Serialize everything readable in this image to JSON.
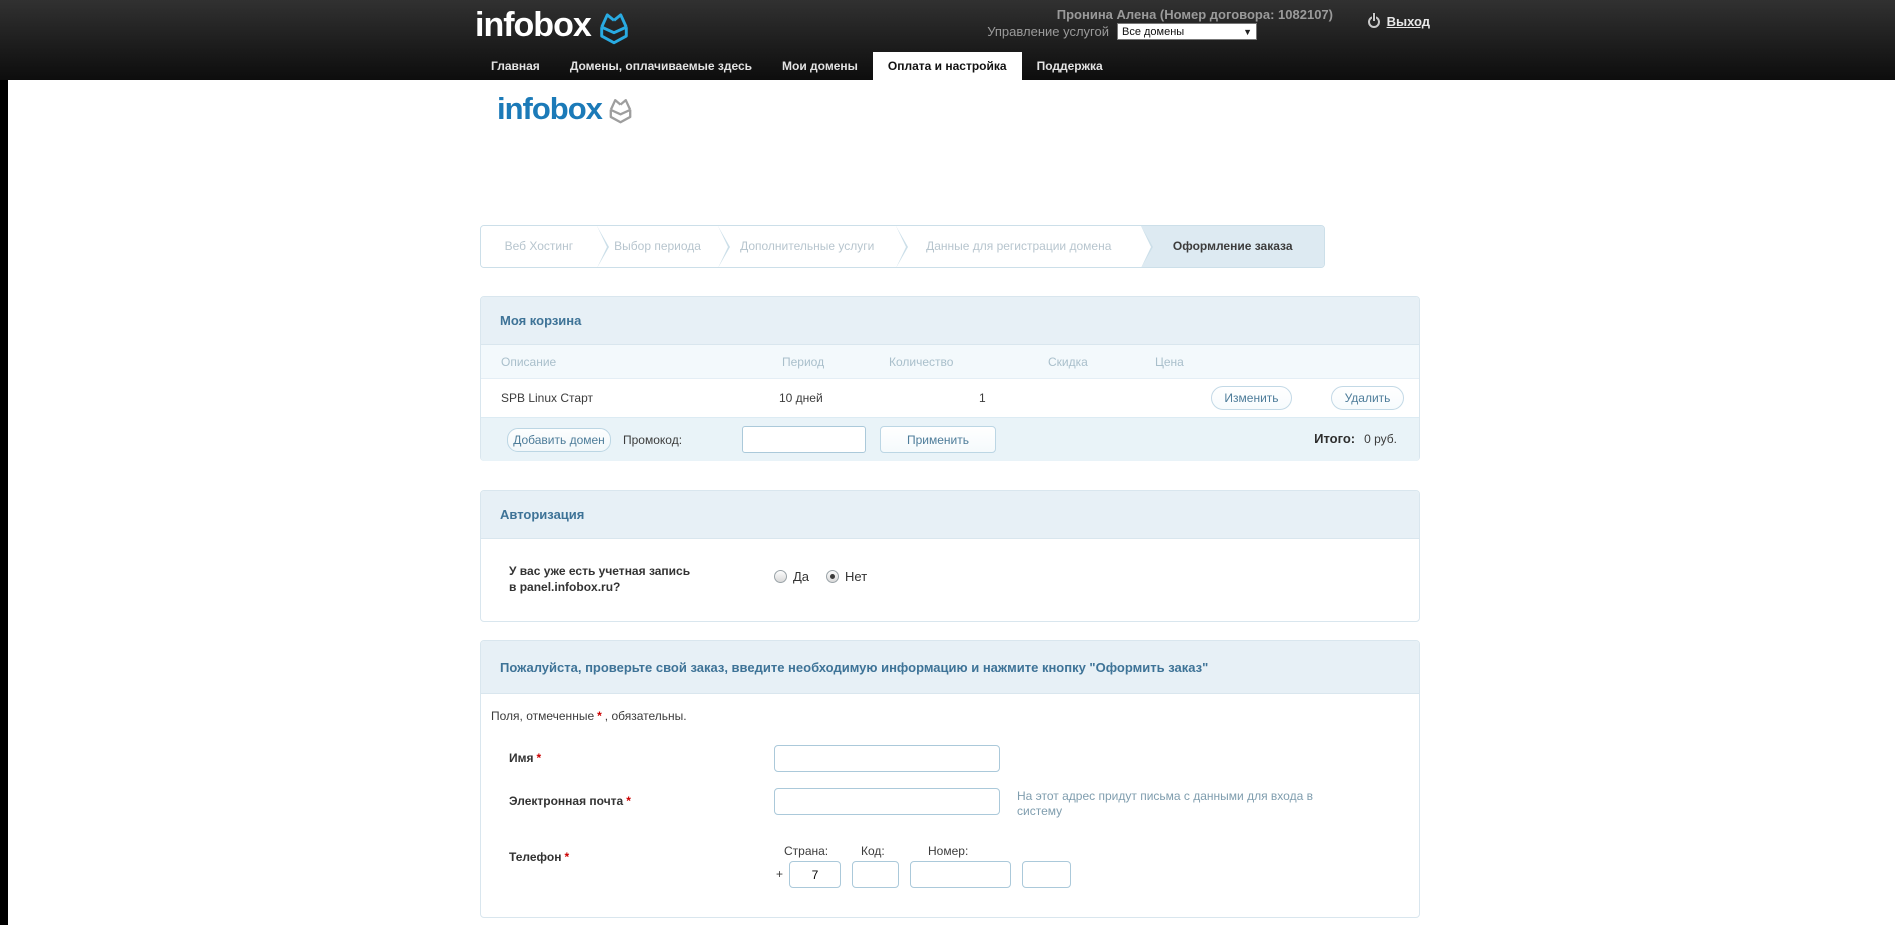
{
  "header": {
    "logo_text": "infobox",
    "user_name": "Пронина Алена (Номер договора: 1082107)",
    "manage_label": "Управление услугой",
    "domain_select_value": "Все домены",
    "logout_label": "Выход",
    "tabs": [
      {
        "label": "Главная",
        "active": false
      },
      {
        "label": "Домены, оплачиваемые здесь",
        "active": false
      },
      {
        "label": "Мои домены",
        "active": false
      },
      {
        "label": "Оплата и настройка",
        "active": true
      },
      {
        "label": "Поддержка",
        "active": false
      }
    ]
  },
  "page_logo_text": "infobox",
  "wizard": {
    "steps": [
      {
        "label": "Веб Хостинг",
        "active": false
      },
      {
        "label": "Выбор периода",
        "active": false
      },
      {
        "label": "Дополнительные услуги",
        "active": false
      },
      {
        "label": "Данные для регистрации домена",
        "active": false
      },
      {
        "label": "Оформление заказа",
        "active": true
      }
    ]
  },
  "cart": {
    "title": "Моя корзина",
    "columns": [
      "Описание",
      "Период",
      "Количество",
      "Скидка",
      "Цена"
    ],
    "row": {
      "description": "SPB Linux Старт",
      "period": "10 дней",
      "quantity": "1",
      "discount": "",
      "price": ""
    },
    "edit_button": "Изменить",
    "delete_button": "Удалить",
    "add_domain_button": "Добавить домен",
    "promo_label": "Промокод:",
    "promo_value": "",
    "apply_button": "Применить",
    "total_label": "Итого:",
    "total_value": "0 руб."
  },
  "auth": {
    "title": "Авторизация",
    "question_line1": "У вас уже есть учетная запись",
    "question_line2": "в panel.infobox.ru?",
    "option_yes": "Да",
    "option_no": "Нет",
    "selected_option": "Нет"
  },
  "order": {
    "title": "Пожалуйста, проверьте свой заказ, введите необходимую информацию и нажмите кнопку \"Оформить заказ\"",
    "required_prefix": "Поля, отмеченные",
    "required_star": "*",
    "required_suffix": ", обязательны.",
    "name_label": "Имя",
    "email_label": "Электронная почта",
    "email_hint": "На этот адрес придут письма с данными для входа в систему",
    "phone_label": "Телефон",
    "country_label": "Страна:",
    "code_label": "Код:",
    "number_label": "Номер:",
    "plus_sign": "+",
    "country_value": "7"
  },
  "colors": {
    "logo_cyan": "#29abe2",
    "content_logo_blue": "#1b7ab8",
    "panel_title_blue": "#3e7397",
    "panel_header_bg": "#e7f0f6",
    "required_red": "#cc0000",
    "header_gradient_top": "#313131",
    "header_gradient_bottom": "#0d0d0d"
  }
}
